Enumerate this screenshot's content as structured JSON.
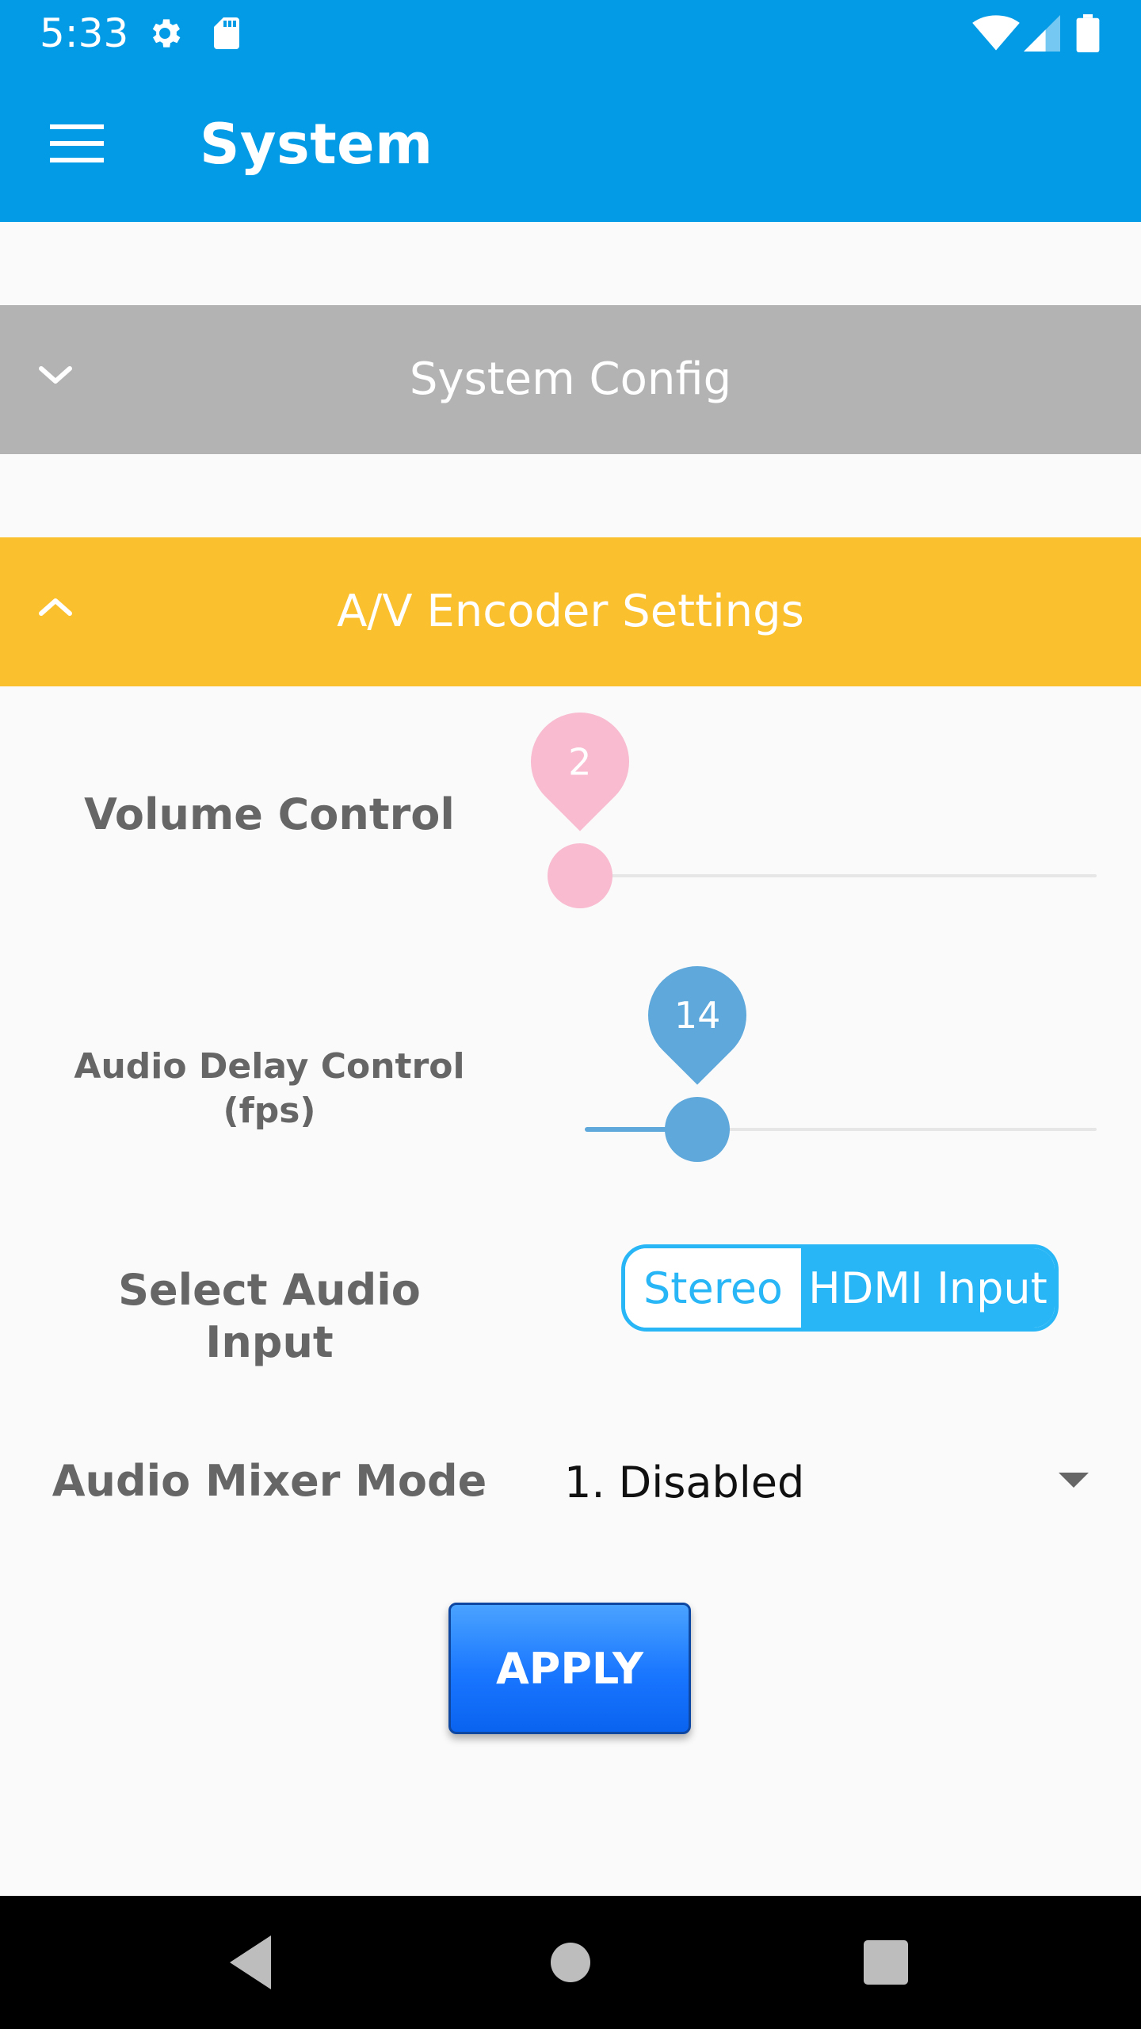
{
  "status_bar": {
    "time": "5:33",
    "icons": [
      "settings-icon",
      "sd-card-icon",
      "wifi-icon",
      "cell-signal-icon",
      "battery-icon"
    ]
  },
  "app_bar": {
    "title": "System",
    "menu_icon": "hamburger-menu-icon",
    "background": "#039be5"
  },
  "sections": [
    {
      "title": "System Config",
      "expanded": false,
      "color": "#b3b3b3"
    },
    {
      "title": "A/V Encoder Settings",
      "expanded": true,
      "color": "#fbc02d"
    }
  ],
  "av_settings": {
    "volume": {
      "label": "Volume Control",
      "value": "2",
      "fraction": 0.03,
      "color": "#f8bbd0"
    },
    "audio_delay": {
      "label": "Audio Delay Control (fps)",
      "value": "14",
      "fraction": 0.22,
      "color": "#5ea8db"
    },
    "audio_input": {
      "label": "Select Audio Input",
      "options": [
        "Stereo",
        "HDMI Input"
      ],
      "selected": "HDMI Input",
      "accent": "#29b6f6"
    },
    "mixer_mode": {
      "label": "Audio Mixer Mode",
      "selected": "1. Disabled"
    },
    "apply_label": "APPLY"
  },
  "nav_bar": {
    "icons": [
      "back-icon",
      "home-icon",
      "recents-icon"
    ]
  }
}
